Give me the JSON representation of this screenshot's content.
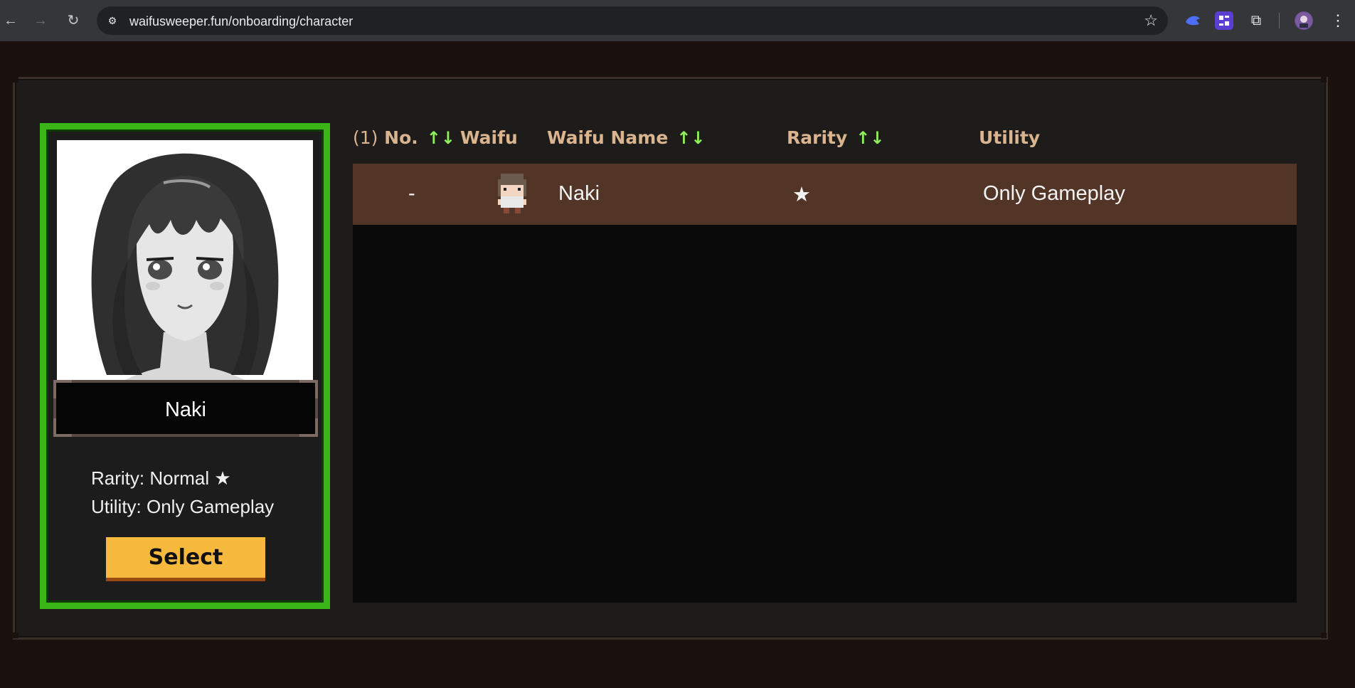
{
  "browser": {
    "url": "waifusweeper.fun/onboarding/character",
    "back_icon": "←",
    "forward_icon": "→",
    "reload_icon": "↻",
    "site_info_icon": "⚙",
    "bookmark_icon": "☆",
    "extensions_icon": "⧉",
    "menu_icon": "⋮"
  },
  "card": {
    "name": "Naki",
    "rarity_line": "Rarity: Normal",
    "rarity_star": "★",
    "utility_line": "Utility: Only Gameplay",
    "select_label": "Select",
    "border_color": "#39b517"
  },
  "table": {
    "headers": {
      "count": "(1)",
      "no": "No.",
      "waifu": "Waifu",
      "name": "Waifu Name",
      "rarity": "Rarity",
      "utility": "Utility",
      "sort_glyph": "↑↓"
    },
    "rows": [
      {
        "no": "-",
        "name": "Naki",
        "rarity": "★",
        "utility": "Only Gameplay",
        "selected": true
      }
    ]
  },
  "colors": {
    "header_text": "#d9b48f",
    "sort_arrows": "#8ef05a",
    "selected_row": "#533527",
    "select_button": "#f5b93d"
  }
}
